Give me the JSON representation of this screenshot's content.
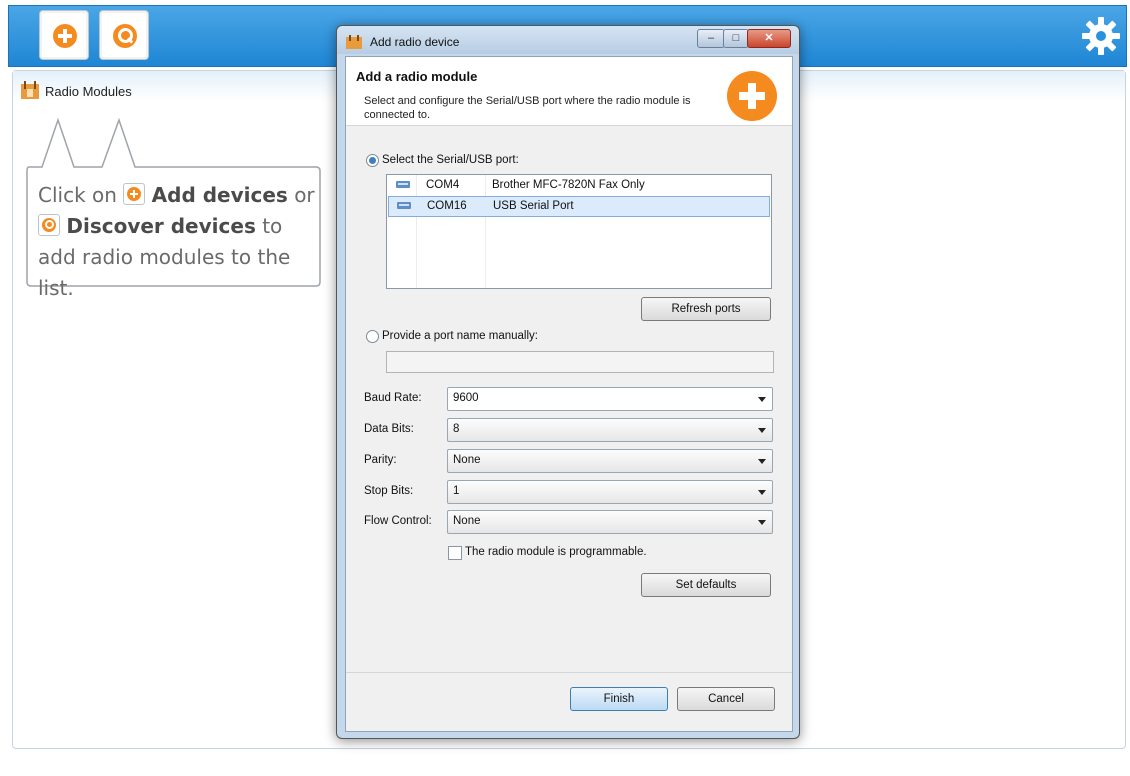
{
  "app": {
    "toolbar": {
      "add_tooltip": "",
      "colors": {
        "bar": "#2a92dc",
        "accent": "#f58a1f"
      },
      "icons": [
        "add-circle-icon",
        "discover-search-icon",
        "settings-gear-icon"
      ]
    },
    "panel": {
      "title": "Radio Modules",
      "hint": {
        "p1": "Click on",
        "add": "Add devices",
        "p2": "or",
        "discover": "Discover devices",
        "p3": "to add radio modules to the list."
      }
    }
  },
  "dialog": {
    "window_title": "Add radio device",
    "header_title": "Add a radio module",
    "header_desc": "Select and configure the Serial/USB port where the radio module is connected to.",
    "select_port_label": "Select the Serial/USB port:",
    "ports": [
      {
        "com": "COM4",
        "desc": "Brother MFC-7820N Fax Only",
        "selected": false
      },
      {
        "com": "COM16",
        "desc": "USB Serial Port",
        "selected": true
      }
    ],
    "refresh_label": "Refresh ports",
    "manual_label": "Provide a port name manually:",
    "manual_value": "",
    "fields": {
      "baud_rate": {
        "label": "Baud Rate:",
        "value": "9600"
      },
      "data_bits": {
        "label": "Data Bits:",
        "value": "8"
      },
      "parity": {
        "label": "Parity:",
        "value": "None"
      },
      "stop_bits": {
        "label": "Stop Bits:",
        "value": "1"
      },
      "flow_control": {
        "label": "Flow Control:",
        "value": "None"
      }
    },
    "programmable_label": "The radio module is programmable.",
    "programmable_checked": false,
    "set_defaults_label": "Set defaults",
    "finish_label": "Finish",
    "cancel_label": "Cancel"
  }
}
